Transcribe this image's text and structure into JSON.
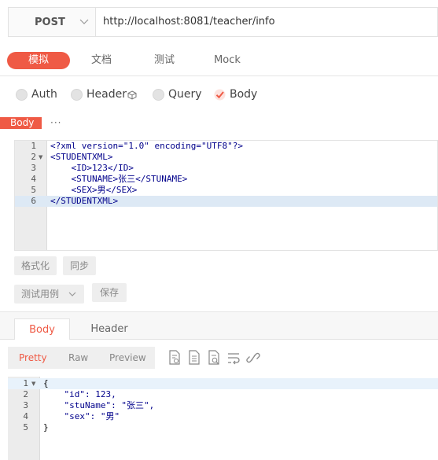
{
  "request": {
    "method": "POST",
    "url": "http://localhost:8081/teacher/info"
  },
  "top_tabs": [
    {
      "label": "模拟",
      "active": true
    },
    {
      "label": "文档",
      "active": false
    },
    {
      "label": "测试",
      "active": false
    },
    {
      "label": "Mock",
      "active": false
    }
  ],
  "options": {
    "auth": "Auth",
    "header": "Header",
    "query": "Query",
    "body": "Body"
  },
  "body_tag": "Body",
  "more": "···",
  "request_body": {
    "line_numbers": [
      "1",
      "2",
      "3",
      "4",
      "5",
      "6"
    ],
    "lines": [
      "<?xml version=\"1.0\" encoding=\"UTF8\"?>",
      "<STUDENTXML>",
      "    <ID>123</ID>",
      "    <STUNAME>张三</STUNAME>",
      "    <SEX>男</SEX>",
      "</STUDENTXML>"
    ]
  },
  "buttons": {
    "format": "格式化",
    "sync": "同步",
    "test_case": "测试用例",
    "save": "保存"
  },
  "response_tabs": [
    {
      "label": "Body",
      "active": true
    },
    {
      "label": "Header",
      "active": false
    }
  ],
  "view_modes": [
    {
      "label": "Pretty",
      "active": true
    },
    {
      "label": "Raw",
      "active": false
    },
    {
      "label": "Preview",
      "active": false
    }
  ],
  "tool_icons": [
    "document-search-icon",
    "document-icon",
    "document-search-icon",
    "wrap-lines-icon",
    "link-icon"
  ],
  "response_body": {
    "line_numbers": [
      "1",
      "2",
      "3",
      "4",
      "5"
    ],
    "lines": [
      "{",
      "    \"id\": 123,",
      "    \"stuName\": \"张三\",",
      "    \"sex\": \"男\"",
      "}"
    ]
  },
  "colors": {
    "accent": "#ef5a45",
    "active_line": "#e8f2fb",
    "gutter": "#ececec"
  }
}
